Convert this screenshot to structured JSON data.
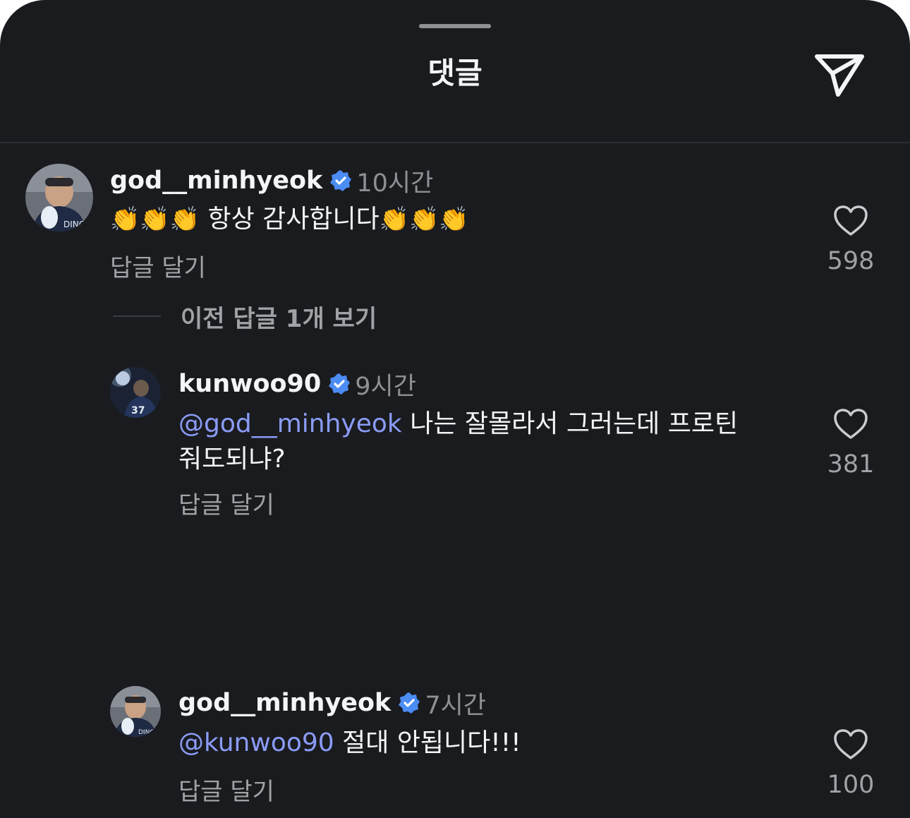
{
  "sheet": {
    "title": "댓글",
    "share_icon": "send-icon"
  },
  "comments": [
    {
      "username": "god__minhyeok",
      "time": "10시간",
      "body_parts": [
        "👏👏👏",
        " 항상 감사합니다",
        "👏👏👏"
      ],
      "reply_label": "답글 달기",
      "likes": "598",
      "verified": true
    }
  ],
  "view_previous": "이전 답글 1개 보기",
  "replies": [
    {
      "username": "kunwoo90",
      "time": "9시간",
      "mention": "@god__minhyeok",
      "text_line1": " 나는 잘몰라서 그러는데 프로틴",
      "text_line2": "줘도되냐?",
      "reply_label": "답글 달기",
      "likes": "381",
      "verified": true
    },
    {
      "username": "god__minhyeok",
      "time": "7시간",
      "mention": "@kunwoo90",
      "text_line1": " 절대 안됩니다!!!",
      "reply_label": "답글 달기",
      "likes": "100",
      "verified": true
    }
  ],
  "colors": {
    "background": "#191b1f",
    "text": "#f3f5f7",
    "secondary": "#a0a2a6",
    "mention": "#8b9cf6",
    "verified": "#4b8cf5"
  }
}
